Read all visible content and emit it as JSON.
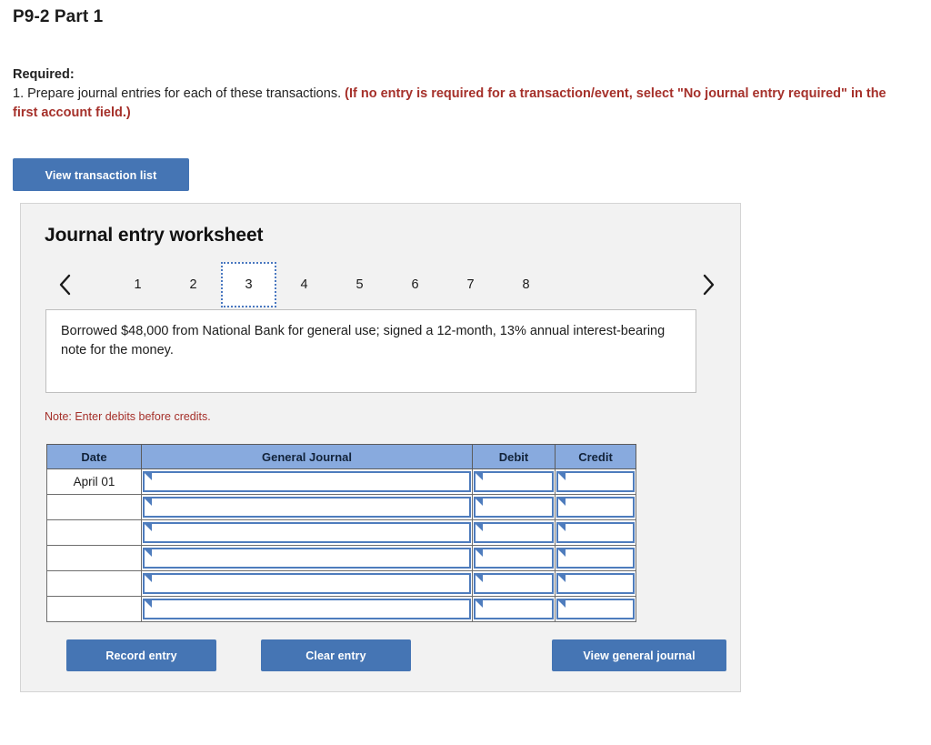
{
  "problem": {
    "title": "P9-2 Part 1",
    "required_label": "Required:",
    "required_text": "1. Prepare journal entries for each of these transactions.",
    "required_note": "(If no entry is required for a transaction/event, select \"No journal entry required\" in the first account field.)"
  },
  "toolbar": {
    "view_transaction_list_label": "View transaction list"
  },
  "worksheet": {
    "title": "Journal entry worksheet",
    "prev_icon": "chevron-left-icon",
    "next_icon": "chevron-right-icon",
    "tabs": [
      {
        "label": "1",
        "active": false
      },
      {
        "label": "2",
        "active": false
      },
      {
        "label": "3",
        "active": true
      },
      {
        "label": "4",
        "active": false
      },
      {
        "label": "5",
        "active": false
      },
      {
        "label": "6",
        "active": false
      },
      {
        "label": "7",
        "active": false
      },
      {
        "label": "8",
        "active": false
      }
    ],
    "transaction_text": "Borrowed $48,000 from National Bank for general use; signed a 12-month, 13% annual interest-bearing note for the money.",
    "note": "Note: Enter debits before credits.",
    "table": {
      "headers": [
        "Date",
        "General Journal",
        "Debit",
        "Credit"
      ],
      "rows": [
        {
          "date": "April 01",
          "general_journal": "",
          "debit": "",
          "credit": ""
        },
        {
          "date": "",
          "general_journal": "",
          "debit": "",
          "credit": ""
        },
        {
          "date": "",
          "general_journal": "",
          "debit": "",
          "credit": ""
        },
        {
          "date": "",
          "general_journal": "",
          "debit": "",
          "credit": ""
        },
        {
          "date": "",
          "general_journal": "",
          "debit": "",
          "credit": ""
        },
        {
          "date": "",
          "general_journal": "",
          "debit": "",
          "credit": ""
        }
      ]
    },
    "buttons": {
      "record_entry": "Record entry",
      "clear_entry": "Clear entry",
      "view_general_journal": "View general journal"
    }
  },
  "colors": {
    "button_blue": "#4575b4",
    "table_header_blue": "#88aade",
    "input_border_blue": "#4e7cbd",
    "accent_red": "#a5302a",
    "panel_gray": "#f2f2f2"
  }
}
